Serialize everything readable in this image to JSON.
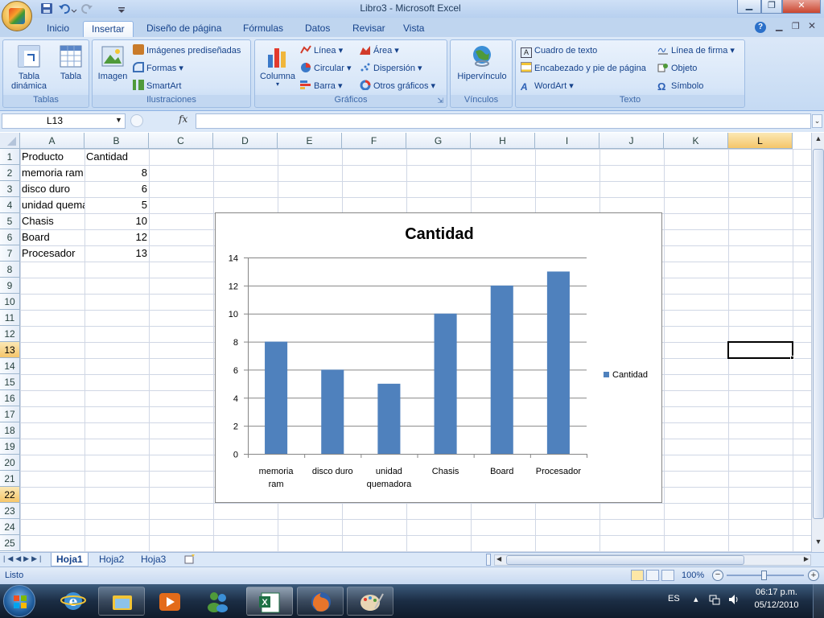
{
  "window": {
    "title": "Libro3 - Microsoft Excel"
  },
  "tabs": [
    "Inicio",
    "Insertar",
    "Diseño de página",
    "Fórmulas",
    "Datos",
    "Revisar",
    "Vista"
  ],
  "active_tab": "Insertar",
  "ribbon": {
    "tablas": {
      "label": "Tablas",
      "tabla_dinamica": "Tabla dinámica",
      "tabla": "Tabla"
    },
    "ilustraciones": {
      "label": "Ilustraciones",
      "imagen": "Imagen",
      "imagenes_prediseñadas": "Imágenes prediseñadas",
      "formas": "Formas",
      "smartart": "SmartArt"
    },
    "graficos": {
      "label": "Gráficos",
      "columna": "Columna",
      "linea": "Línea",
      "circular": "Circular",
      "barra": "Barra",
      "area": "Área",
      "dispersion": "Dispersión",
      "otros": "Otros gráficos"
    },
    "vinculos": {
      "label": "Vínculos",
      "hipervinculo": "Hipervínculo"
    },
    "texto": {
      "label": "Texto",
      "cuadro": "Cuadro de texto",
      "encabezado": "Encabezado y pie de página",
      "wordart": "WordArt",
      "linea_firma": "Línea de firma",
      "objeto": "Objeto",
      "simbolo": "Símbolo"
    }
  },
  "formula_bar": {
    "name_box": "L13",
    "fx": "fx",
    "formula": ""
  },
  "columns": [
    "A",
    "B",
    "C",
    "D",
    "E",
    "F",
    "G",
    "H",
    "I",
    "J",
    "K",
    "L"
  ],
  "selected_column": "L",
  "selected_rows": [
    "13",
    "22"
  ],
  "rows": [
    "1",
    "2",
    "3",
    "4",
    "5",
    "6",
    "7",
    "8",
    "9",
    "10",
    "11",
    "12",
    "13",
    "14",
    "15",
    "16",
    "17",
    "18",
    "19",
    "20",
    "21",
    "22",
    "23",
    "24",
    "25"
  ],
  "sheet": {
    "headers": {
      "a": "Producto",
      "b": "Cantidad"
    },
    "data": [
      {
        "producto": "memoria ram",
        "cantidad": "8"
      },
      {
        "producto": "disco duro",
        "cantidad": "6"
      },
      {
        "producto": "unidad quemadora",
        "cantidad": "5"
      },
      {
        "producto": "Chasis",
        "cantidad": "10"
      },
      {
        "producto": "Board",
        "cantidad": "12"
      },
      {
        "producto": "Procesador",
        "cantidad": "13"
      }
    ]
  },
  "chart_data": {
    "type": "bar",
    "title": "Cantidad",
    "categories": [
      "memoria ram",
      "disco duro",
      "unidad quemadora",
      "Chasis",
      "Board",
      "Procesador"
    ],
    "category_lines": [
      [
        "memoria",
        "ram"
      ],
      [
        "disco duro"
      ],
      [
        "unidad",
        "quemadora"
      ],
      [
        "Chasis"
      ],
      [
        "Board"
      ],
      [
        "Procesador"
      ]
    ],
    "series": [
      {
        "name": "Cantidad",
        "values": [
          8,
          6,
          5,
          10,
          12,
          13
        ],
        "color": "#4f81bd"
      }
    ],
    "ylim": [
      0,
      14
    ],
    "yticks": [
      "0",
      "2",
      "4",
      "6",
      "8",
      "10",
      "12",
      "14"
    ],
    "grid": true,
    "legend": "right"
  },
  "sheet_tabs": [
    "Hoja1",
    "Hoja2",
    "Hoja3"
  ],
  "active_sheet": "Hoja1",
  "status": {
    "text": "Listo",
    "zoom": "100%"
  },
  "taskbar": {
    "lang": "ES",
    "time": "06:17 p.m.",
    "date": "05/12/2010"
  },
  "colors": {
    "accent": "#15428b",
    "bar": "#4f81bd"
  }
}
